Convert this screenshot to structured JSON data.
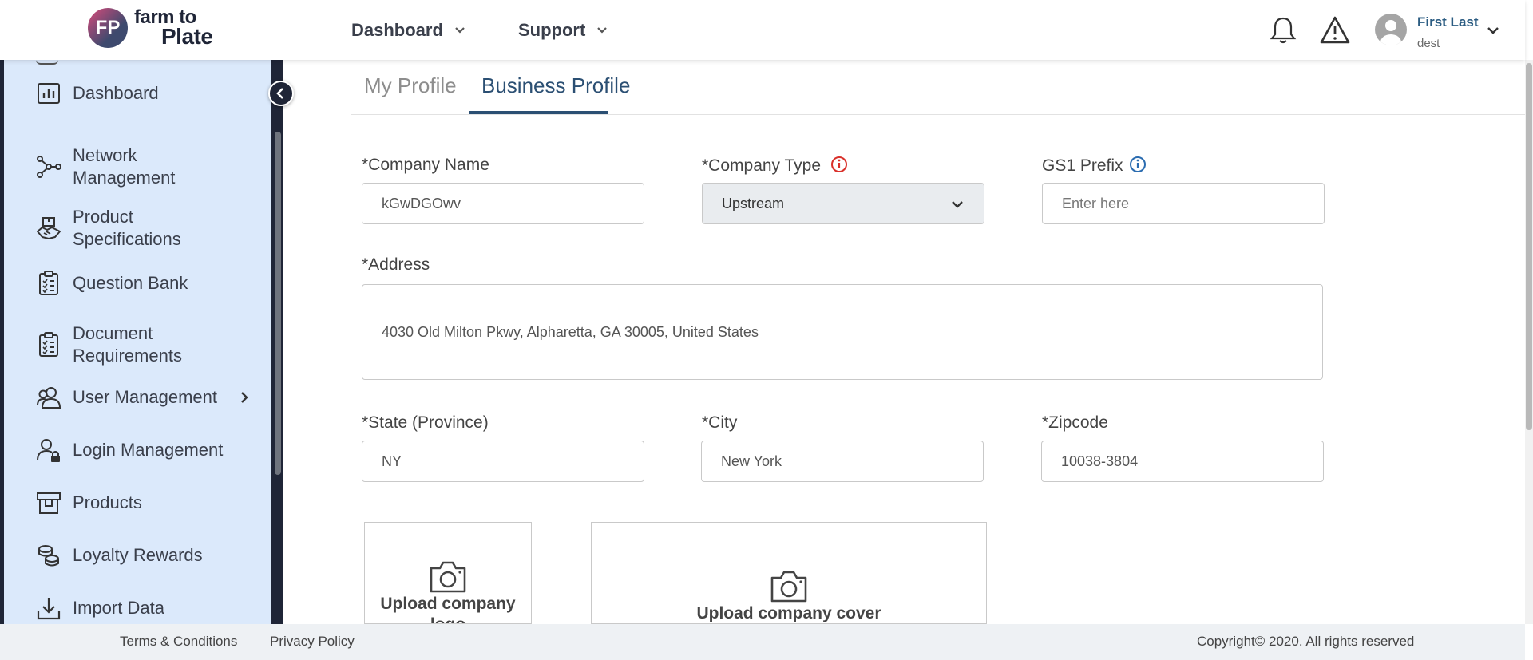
{
  "header": {
    "logo_text_line1": "farm to",
    "logo_text_line2": "Plate",
    "logo_mark": "FP",
    "nav": [
      {
        "label": "Dashboard"
      },
      {
        "label": "Support"
      }
    ],
    "user": {
      "name": "First Last",
      "role": "dest"
    },
    "icons": [
      "bell-icon",
      "warning-icon",
      "avatar-icon",
      "chevron-down-icon"
    ]
  },
  "sidebar": {
    "items": [
      {
        "label": "Dashboard",
        "icon": "bar-chart-icon"
      },
      {
        "label": "Network\nManagement",
        "icon": "network-icon"
      },
      {
        "label": "Product\nSpecifications",
        "icon": "handshake-icon"
      },
      {
        "label": "Question Bank",
        "icon": "checklist-icon"
      },
      {
        "label": "Document\nRequirements",
        "icon": "checklist-icon"
      },
      {
        "label": "User Management",
        "icon": "users-icon"
      },
      {
        "label": "Login Management",
        "icon": "user-lock-icon"
      },
      {
        "label": "Products",
        "icon": "box-icon"
      },
      {
        "label": "Loyalty Rewards",
        "icon": "coins-icon"
      },
      {
        "label": "Import Data",
        "icon": "download-icon"
      }
    ]
  },
  "tabs": [
    {
      "label": "My Profile",
      "active": false
    },
    {
      "label": "Business Profile",
      "active": true
    }
  ],
  "form": {
    "company_name": {
      "label": "*Company Name",
      "value": "kGwDGOwv"
    },
    "company_type": {
      "label": "*Company Type",
      "value": "Upstream"
    },
    "gs1_prefix": {
      "label": "GS1 Prefix",
      "placeholder": "Enter here"
    },
    "address": {
      "label": "*Address",
      "value": "4030 Old Milton Pkwy, Alpharetta, GA 30005, United States"
    },
    "state": {
      "label": "*State (Province)",
      "value": "NY"
    },
    "city": {
      "label": "*City",
      "value": "New York"
    },
    "zipcode": {
      "label": "*Zipcode",
      "value": "10038-3804"
    },
    "upload_logo": "Upload company logo",
    "upload_cover": "Upload company cover"
  },
  "footer": {
    "terms": "Terms & Conditions",
    "privacy": "Privacy Policy",
    "copyright": "Copyright© 2020. All rights reserved"
  },
  "colors": {
    "sidebar_bg": "#dbe9fb",
    "sidebar_dark": "#1f2537",
    "accent": "#2b4f73",
    "info_red": "#d9302a",
    "info_blue": "#2b6cb0"
  }
}
